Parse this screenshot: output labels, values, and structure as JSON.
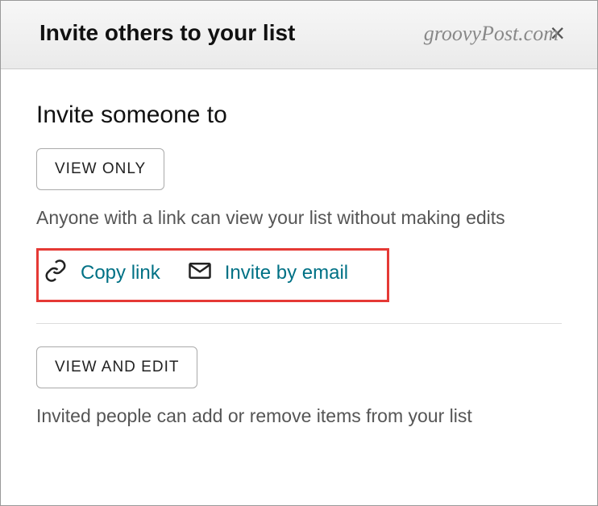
{
  "watermark": "groovyPost.com",
  "header": {
    "title": "Invite others to your list"
  },
  "main": {
    "subtitle": "Invite someone to",
    "view_only": {
      "button_label": "VIEW ONLY",
      "description": "Anyone with a link can view your list without making edits",
      "copy_link_label": "Copy link",
      "invite_email_label": "Invite by email"
    },
    "view_edit": {
      "button_label": "VIEW AND EDIT",
      "description": "Invited people can add or remove items from your list"
    }
  }
}
